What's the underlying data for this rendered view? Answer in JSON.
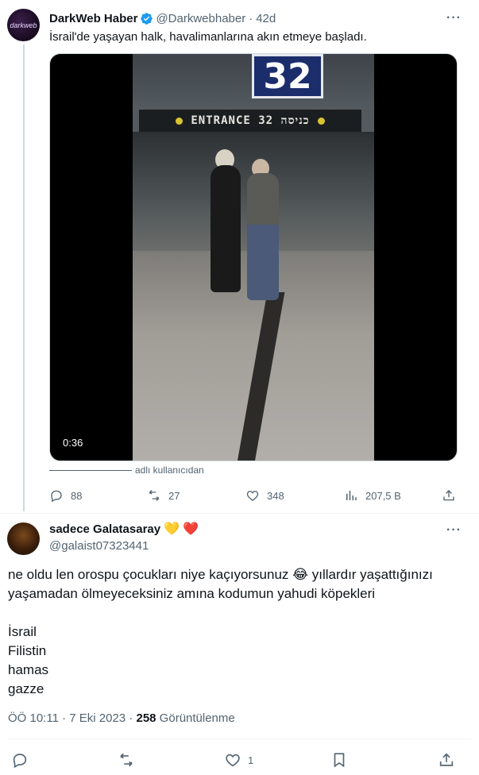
{
  "parent_tweet": {
    "author_name": "DarkWeb Haber",
    "author_handle": "@Darkwebhaber",
    "time_ago": "42d",
    "avatar_text": "darkweb",
    "text": "İsrail'de yaşayan halk, havalimanlarına akın etmeye başladı.",
    "video": {
      "duration": "0:36",
      "sign_number": "32",
      "sign_text": "ENTRANCE  32  כניסה"
    },
    "attribution": "adlı kullanıcıdan",
    "stats": {
      "replies": "88",
      "retweets": "27",
      "likes": "348",
      "views": "207,5 B"
    }
  },
  "reply_tweet": {
    "author_name": "sadece Galatasaray",
    "name_emojis": [
      "💛",
      "❤️"
    ],
    "author_handle": "@galaist07323441",
    "lines": [
      "ne oldu len orospu çocukları niye kaçıyorsunuz 😂 yıllardır yaşattığınızı",
      "yaşamadan ölmeyeceksiniz amına kodumun yahudi köpekleri",
      "",
      "İsrail",
      "Filistin",
      "hamas",
      "gazze"
    ],
    "meta_time": "ÖÖ 10:11 · 7 Eki 2023 · ",
    "meta_views_count": "258",
    "meta_views_label": " Görüntülenme",
    "likes": "1"
  },
  "colors": {
    "verified": "#1d9bf0",
    "secondary_text": "#536471",
    "primary_text": "#0f1419",
    "divider": "#eff3f4"
  },
  "icons": [
    "more-icon",
    "verified-badge-icon",
    "reply-icon",
    "retweet-icon",
    "like-icon",
    "views-icon",
    "share-icon",
    "bookmark-icon"
  ]
}
